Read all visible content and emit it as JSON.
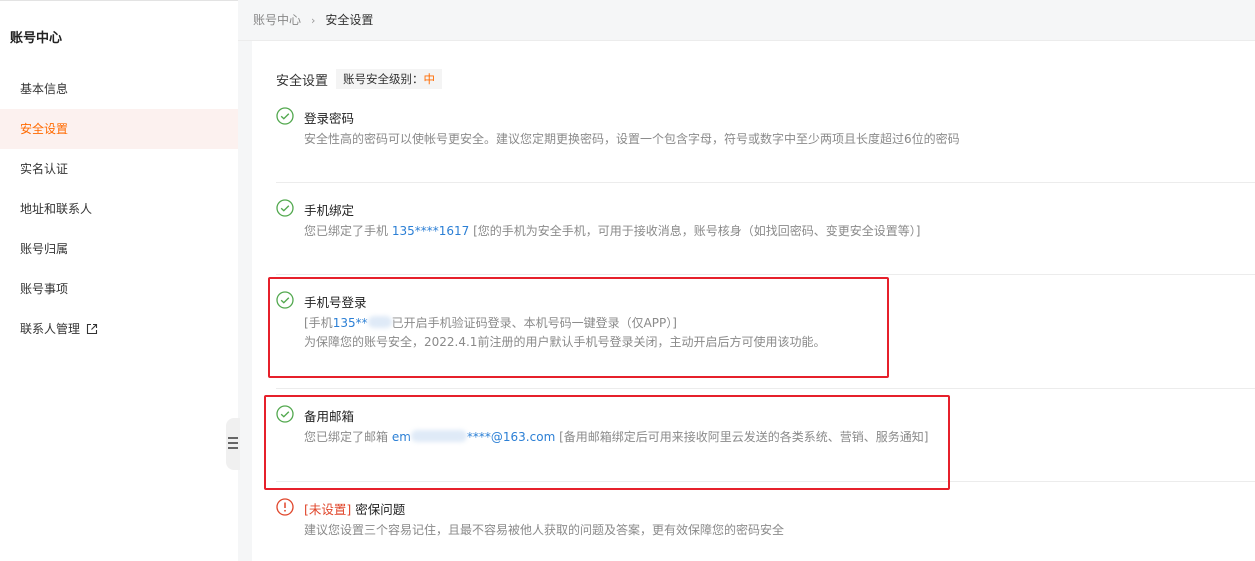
{
  "sidebar": {
    "title": "账号中心",
    "items": [
      {
        "label": "基本信息"
      },
      {
        "label": "安全设置"
      },
      {
        "label": "实名认证"
      },
      {
        "label": "地址和联系人"
      },
      {
        "label": "账号归属"
      },
      {
        "label": "账号事项"
      },
      {
        "label": "联系人管理"
      }
    ]
  },
  "breadcrumb": {
    "root": "账号中心",
    "separator": "›",
    "current": "安全设置"
  },
  "panel": {
    "title": "安全设置",
    "level_label": "账号安全级别：",
    "level_value": "中"
  },
  "items": {
    "password": {
      "title": "登录密码",
      "desc": "安全性高的密码可以使帐号更安全。建议您定期更换密码，设置一个包含字母，符号或数字中至少两项且长度超过6位的密码"
    },
    "phone": {
      "title": "手机绑定",
      "desc_prefix": "您已绑定了手机 ",
      "phone_number": "135****1617",
      "desc_suffix": " [您的手机为安全手机，可用于接收消息，账号核身（如找回密码、变更安全设置等）]"
    },
    "phone_login": {
      "title": "手机号登录",
      "line1_prefix": "[手机",
      "line1_number": "135**",
      "line1_suffix": "已开启手机验证码登录、本机号码一键登录（仅APP）]",
      "line2": "为保障您的账号安全，2022.4.1前注册的用户默认手机号登录关闭，主动开启后方可使用该功能。"
    },
    "email": {
      "title": "备用邮箱",
      "desc_prefix": "您已绑定了邮箱 ",
      "email_start": "em",
      "email_end": "****@163.com",
      "desc_suffix": " [备用邮箱绑定后可用来接收阿里云发送的各类系统、营销、服务通知]"
    },
    "security_question": {
      "status": "[未设置]",
      "title": "密保问题",
      "desc": "建议您设置三个容易记住，且最不容易被他人获取的问题及答案，更有效保障您的密码安全"
    }
  },
  "colors": {
    "accent": "#ff6a00",
    "check": "#52a84e",
    "warning": "#e0462b",
    "link": "#2b7fd5",
    "highlight_box": "#e6202b"
  },
  "icons": {
    "ok": "check-circle-icon",
    "warn": "exclamation-circle-icon",
    "external": "external-link-icon",
    "collapse": "menu-collapse-icon"
  }
}
